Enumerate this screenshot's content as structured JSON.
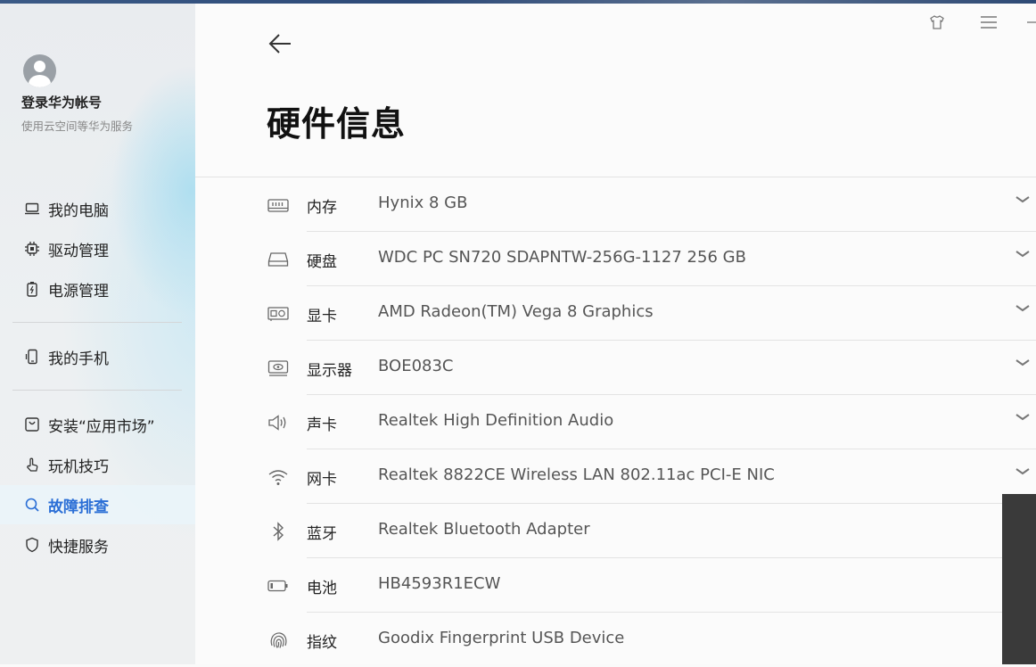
{
  "sidebar": {
    "account_title": "登录华为帐号",
    "account_subtitle": "使用云空间等华为服务",
    "group1": [
      {
        "label": "我的电脑",
        "icon": "laptop-icon"
      },
      {
        "label": "驱动管理",
        "icon": "chip-icon"
      },
      {
        "label": "电源管理",
        "icon": "battery-plug-icon"
      }
    ],
    "group2": [
      {
        "label": "我的手机",
        "icon": "phone-icon"
      }
    ],
    "group3": [
      {
        "label": "安装“应用市场”",
        "icon": "app-store-icon"
      },
      {
        "label": "玩机技巧",
        "icon": "hand-tap-icon"
      },
      {
        "label": "故障排查",
        "icon": "search-icon",
        "active": true
      },
      {
        "label": "快捷服务",
        "icon": "shield-icon"
      }
    ]
  },
  "main": {
    "title": "硬件信息",
    "hardware": [
      {
        "label": "内存",
        "value": "Hynix 8 GB",
        "icon": "memory-icon",
        "expandable": true
      },
      {
        "label": "硬盘",
        "value": "WDC PC SN720 SDAPNTW-256G-1127 256 GB",
        "icon": "disk-icon",
        "expandable": true
      },
      {
        "label": "显卡",
        "value": "AMD Radeon(TM) Vega 8 Graphics",
        "icon": "gpu-icon",
        "expandable": true
      },
      {
        "label": "显示器",
        "value": "BOE083C",
        "icon": "monitor-icon",
        "expandable": true
      },
      {
        "label": "声卡",
        "value": "Realtek High Definition Audio",
        "icon": "speaker-icon",
        "expandable": true
      },
      {
        "label": "网卡",
        "value": "Realtek 8822CE Wireless LAN 802.11ac PCI-E NIC",
        "icon": "wifi-icon",
        "expandable": true
      },
      {
        "label": "蓝牙",
        "value": "Realtek Bluetooth Adapter",
        "icon": "bluetooth-icon",
        "expandable": false
      },
      {
        "label": "电池",
        "value": "HB4593R1ECW",
        "icon": "battery-icon",
        "expandable": false
      },
      {
        "label": "指纹",
        "value": "Goodix Fingerprint USB Device",
        "icon": "fingerprint-icon",
        "expandable": false
      }
    ]
  },
  "colors": {
    "accent": "#2b6fd6",
    "text": "#222222",
    "value_text": "#555555",
    "divider": "#e3e3e3"
  }
}
